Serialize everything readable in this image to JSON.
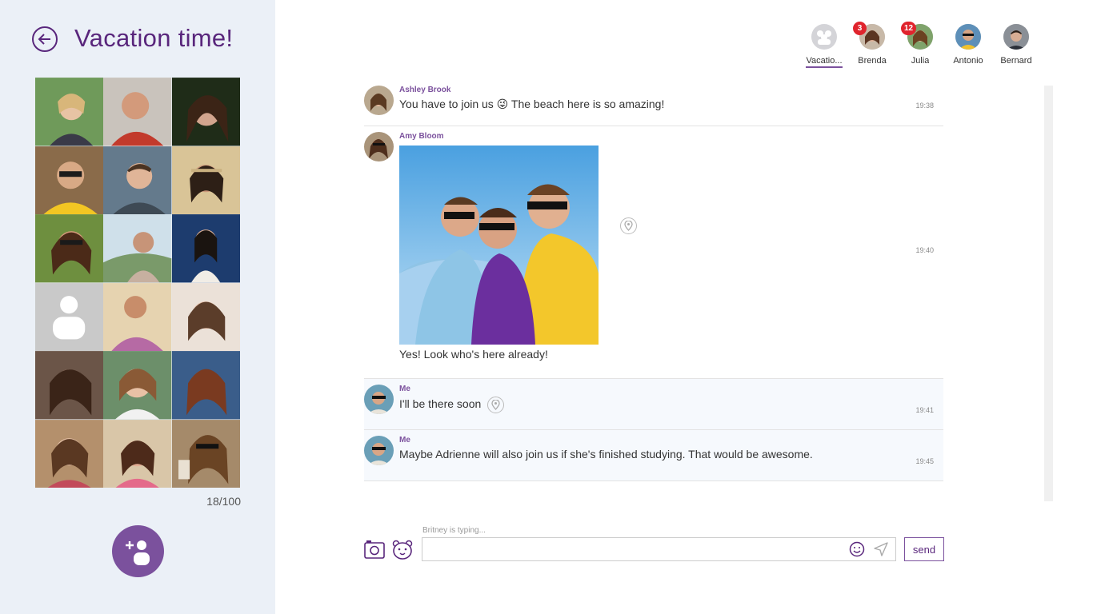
{
  "sidebar": {
    "title": "Vacation time!",
    "member_count": "18/100"
  },
  "header": {
    "contacts": [
      {
        "name": "Vacatio...",
        "badge": "",
        "active": true
      },
      {
        "name": "Brenda",
        "badge": "3"
      },
      {
        "name": "Julia",
        "badge": "12"
      },
      {
        "name": "Antonio",
        "badge": ""
      },
      {
        "name": "Bernard",
        "badge": ""
      }
    ]
  },
  "messages": [
    {
      "sender": "Ashley Brook",
      "text": "You have to join us 😜 The beach here is so amazing!",
      "time": "19:38"
    },
    {
      "sender": "Amy Bloom",
      "text": "Yes! Look who's here already!",
      "time": "19:40"
    },
    {
      "sender": "Me",
      "text": "I'll be there soon",
      "time": "19:41"
    },
    {
      "sender": "Me",
      "text": "Maybe Adrienne will also join us if she's finished studying. That would be awesome.",
      "time": "19:45"
    }
  ],
  "composer": {
    "typing": "Britney  is typing...",
    "placeholder": "",
    "send_label": "send"
  },
  "colors": {
    "accent": "#7b519d",
    "sidebar_bg": "#ebf0f7",
    "badge": "#e0242d"
  }
}
